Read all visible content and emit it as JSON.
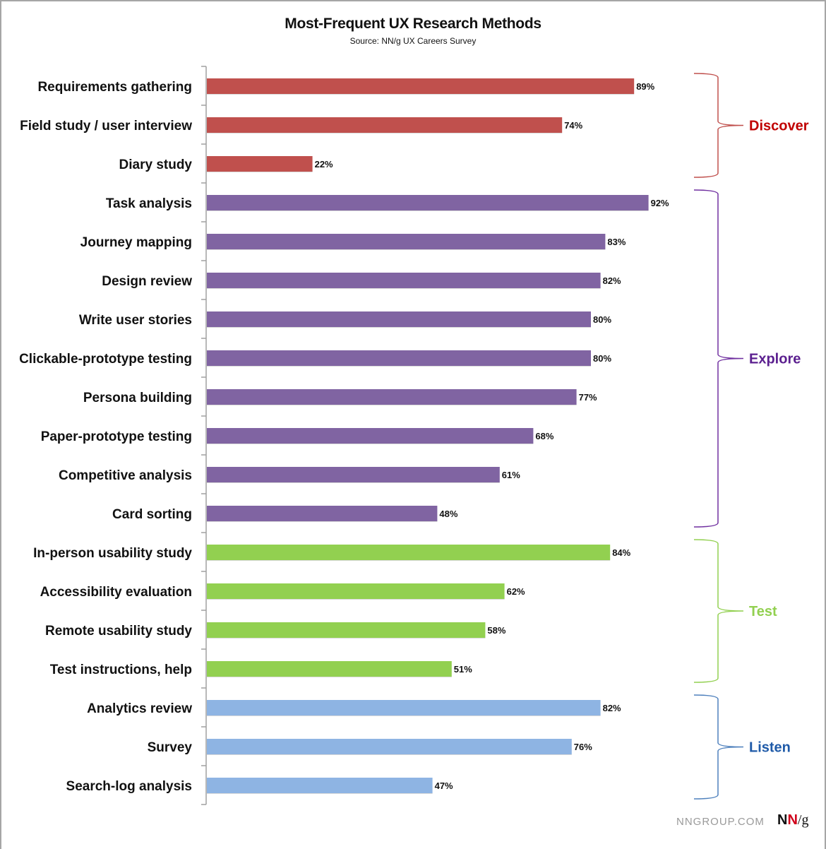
{
  "chart_data": {
    "type": "bar",
    "orientation": "horizontal",
    "title": "Most-Frequent UX Research Methods",
    "subtitle": "Source: NN/g UX Careers Survey",
    "xlabel": "",
    "ylabel": "",
    "xlim": [
      0,
      100
    ],
    "value_format": "percent",
    "grid": false,
    "categories": [
      "Requirements gathering",
      "Field study / user interview",
      "Diary study",
      "Task analysis",
      "Journey mapping",
      "Design review",
      "Write user stories",
      "Clickable-prototype testing",
      "Persona building",
      "Paper-prototype testing",
      "Competitive analysis",
      "Card sorting",
      "In-person usability study",
      "Accessibility evaluation",
      "Remote usability study",
      "Test instructions, help",
      "Analytics review",
      "Survey",
      "Search-log analysis"
    ],
    "values": [
      89,
      74,
      22,
      92,
      83,
      82,
      80,
      80,
      77,
      68,
      61,
      48,
      84,
      62,
      58,
      51,
      82,
      76,
      47
    ],
    "value_labels": [
      "89%",
      "74%",
      "22%",
      "92%",
      "83%",
      "82%",
      "80%",
      "80%",
      "77%",
      "68%",
      "61%",
      "48%",
      "84%",
      "62%",
      "58%",
      "51%",
      "82%",
      "76%",
      "47%"
    ],
    "groups": [
      {
        "name": "Discover",
        "start": 0,
        "end": 2,
        "bar_color": "#c0504d",
        "label_color": "#c00000",
        "brace_color": "#c0504d"
      },
      {
        "name": "Explore",
        "start": 3,
        "end": 11,
        "bar_color": "#8064a2",
        "label_color": "#5b1f8f",
        "brace_color": "#7030a0"
      },
      {
        "name": "Test",
        "start": 12,
        "end": 15,
        "bar_color": "#92d050",
        "label_color": "#92d050",
        "brace_color": "#92d050"
      },
      {
        "name": "Listen",
        "start": 16,
        "end": 18,
        "bar_color": "#8eb4e3",
        "label_color": "#1f5aa8",
        "brace_color": "#4f81bd"
      }
    ]
  },
  "footer": {
    "site": "NNGROUP.COM",
    "logo_n1": "N",
    "logo_n2": "N",
    "logo_g": "/g"
  }
}
